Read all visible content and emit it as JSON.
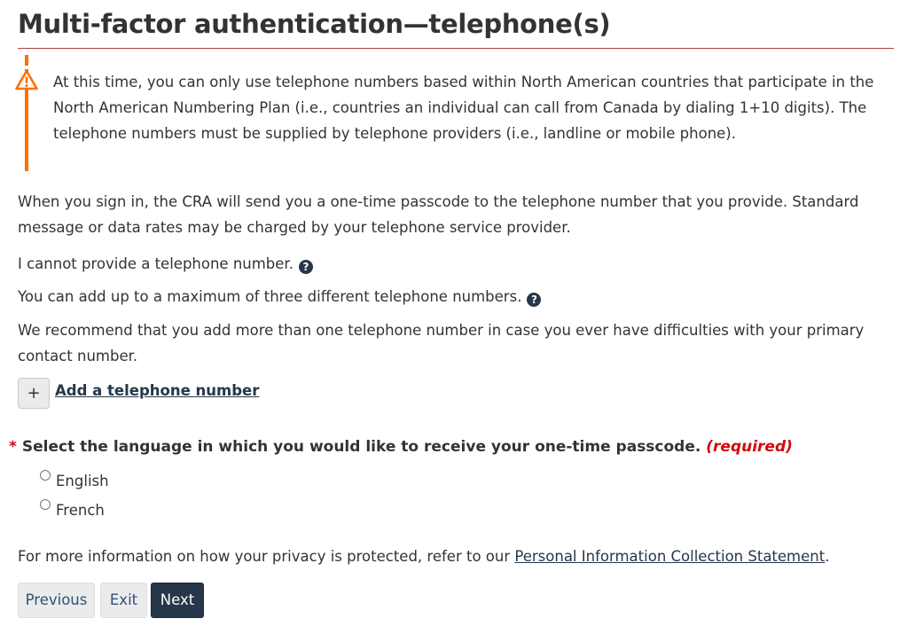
{
  "page": {
    "title": "Multi-factor authentication—telephone(s)"
  },
  "warning": {
    "icon": "warning-triangle-icon",
    "text": "At this time, you can only use telephone numbers based within North American countries that participate in the North American Numbering Plan (i.e., countries an individual can call from Canada by dialing 1+10 digits). The telephone numbers must be supplied by telephone providers (i.e., landline or mobile phone).",
    "color": "#ff6e00"
  },
  "content": {
    "intro": "When you sign in, the CRA will send you a one-time passcode to the telephone number that you provide. Standard message or data rates may be charged by your telephone service provider.",
    "cannot_provide": "I cannot provide a telephone number.",
    "max_numbers": "You can add up to a maximum of three different telephone numbers.",
    "recommend": "We recommend that you add more than one telephone number in case you ever have difficulties with your primary contact number.",
    "help_icon": "question-circle-icon"
  },
  "add_phone": {
    "button_symbol": "+",
    "link_label": "Add a telephone number"
  },
  "language": {
    "required_marker": "*",
    "question": "Select the language in which you would like to receive your one-time passcode.",
    "required_label": "(required)",
    "options": [
      {
        "label": "English",
        "selected": false
      },
      {
        "label": "French",
        "selected": false
      }
    ]
  },
  "privacy": {
    "prefix": "For more information on how your privacy is protected, refer to our ",
    "link": "Personal Information Collection Statement",
    "suffix": "."
  },
  "buttons": {
    "previous": "Previous",
    "exit": "Exit",
    "next": "Next"
  },
  "colors": {
    "accent_red": "#af3c43",
    "required_red": "#d3080c",
    "primary_button": "#26374a",
    "link": "#26374a"
  }
}
